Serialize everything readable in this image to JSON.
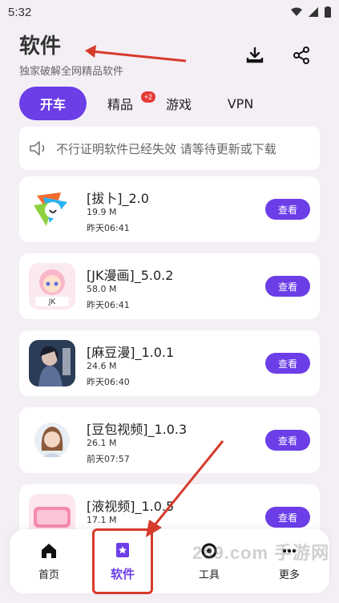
{
  "status_bar": {
    "time": "5:32"
  },
  "header": {
    "title": "软件",
    "subtitle": "独家破解全网精品软件",
    "actions": {
      "download_icon": "download-icon",
      "share_icon": "share-icon"
    }
  },
  "tabs": [
    {
      "label": "开车",
      "active": true
    },
    {
      "label": "精品",
      "badge": "+2"
    },
    {
      "label": "游戏"
    },
    {
      "label": "VPN"
    }
  ],
  "notice": {
    "text": "不行证明软件已经失效 请等待更新或下载"
  },
  "apps": [
    {
      "name": "[拔卜]_2.0",
      "size": "19.9 M",
      "time": "昨天06:41",
      "button": "查看"
    },
    {
      "name": "[JK漫画]_5.0.2",
      "size": "58.0 M",
      "time": "昨天06:41",
      "button": "查看"
    },
    {
      "name": "[麻豆漫]_1.0.1",
      "size": "24.6 M",
      "time": "昨天06:40",
      "button": "查看"
    },
    {
      "name": "[豆包视频]_1.0.3",
      "size": "26.1 M",
      "time": "前天07:57",
      "button": "查看"
    },
    {
      "name": "[液视频]_1.0.5",
      "size": "17.1 M",
      "time": "",
      "button": "查看"
    }
  ],
  "bottom_nav": [
    {
      "label": "首页",
      "icon": "home-icon"
    },
    {
      "label": "软件",
      "icon": "star-bookmark-icon",
      "active": true
    },
    {
      "label": "工具",
      "icon": "tools-icon"
    },
    {
      "label": "更多",
      "icon": "more-icon"
    }
  ],
  "watermark": "289.com 手游网",
  "colors": {
    "accent": "#6b3ee8",
    "background": "#f3eff5",
    "annotation": "#d63b2c"
  }
}
